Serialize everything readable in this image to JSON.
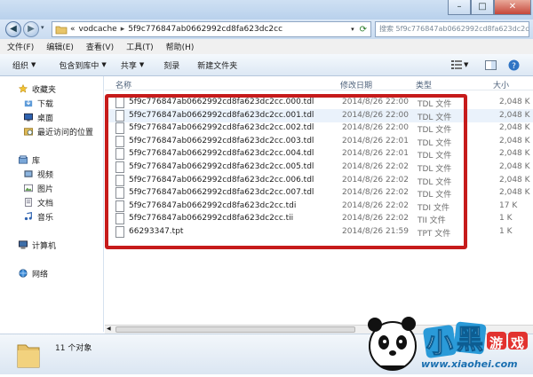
{
  "address": {
    "chevron": "«",
    "folder": "vodcache",
    "sep": "▸",
    "path_tail": "5f9c776847ab0662992cd8fa623dc2cc",
    "search_placeholder": "搜索 5f9c776847ab0662992cd8fa623dc2cc"
  },
  "menu": [
    "文件(F)",
    "编辑(E)",
    "查看(V)",
    "工具(T)",
    "帮助(H)"
  ],
  "toolbar": {
    "organize": "组织",
    "include": "包含到库中",
    "share": "共享",
    "burn": "刻录",
    "new_folder": "新建文件夹"
  },
  "sidebar": {
    "favorites": "收藏夹",
    "fav_items": [
      "下载",
      "桌面",
      "最近访问的位置"
    ],
    "libraries": "库",
    "lib_items": [
      "视频",
      "图片",
      "文档",
      "音乐"
    ],
    "computer": "计算机",
    "network": "网络"
  },
  "columns": {
    "name": "名称",
    "date": "修改日期",
    "type": "类型",
    "size": "大小"
  },
  "files": [
    {
      "name": "5f9c776847ab0662992cd8fa623dc2cc.000.tdl",
      "date": "2014/8/26 22:00",
      "type": "TDL 文件",
      "size": "2,048 K"
    },
    {
      "name": "5f9c776847ab0662992cd8fa623dc2cc.001.tdl",
      "date": "2014/8/26 22:00",
      "type": "TDL 文件",
      "size": "2,048 K"
    },
    {
      "name": "5f9c776847ab0662992cd8fa623dc2cc.002.tdl",
      "date": "2014/8/26 22:00",
      "type": "TDL 文件",
      "size": "2,048 K"
    },
    {
      "name": "5f9c776847ab0662992cd8fa623dc2cc.003.tdl",
      "date": "2014/8/26 22:01",
      "type": "TDL 文件",
      "size": "2,048 K"
    },
    {
      "name": "5f9c776847ab0662992cd8fa623dc2cc.004.tdl",
      "date": "2014/8/26 22:01",
      "type": "TDL 文件",
      "size": "2,048 K"
    },
    {
      "name": "5f9c776847ab0662992cd8fa623dc2cc.005.tdl",
      "date": "2014/8/26 22:02",
      "type": "TDL 文件",
      "size": "2,048 K"
    },
    {
      "name": "5f9c776847ab0662992cd8fa623dc2cc.006.tdl",
      "date": "2014/8/26 22:02",
      "type": "TDL 文件",
      "size": "2,048 K"
    },
    {
      "name": "5f9c776847ab0662992cd8fa623dc2cc.007.tdl",
      "date": "2014/8/26 22:02",
      "type": "TDL 文件",
      "size": "2,048 K"
    },
    {
      "name": "5f9c776847ab0662992cd8fa623dc2cc.tdi",
      "date": "2014/8/26 22:02",
      "type": "TDI 文件",
      "size": "17 K"
    },
    {
      "name": "5f9c776847ab0662992cd8fa623dc2cc.tii",
      "date": "2014/8/26 22:02",
      "type": "TII 文件",
      "size": "1 K"
    },
    {
      "name": "66293347.tpt",
      "date": "2014/8/26 21:59",
      "type": "TPT 文件",
      "size": "1 K"
    }
  ],
  "status": {
    "count": "11 个对象"
  },
  "watermark": {
    "brand": "小黑游戏",
    "url": "www.xiaohei.com"
  },
  "colors": {
    "highlight": "#c61b1b",
    "accent": "#1a8fd8"
  }
}
